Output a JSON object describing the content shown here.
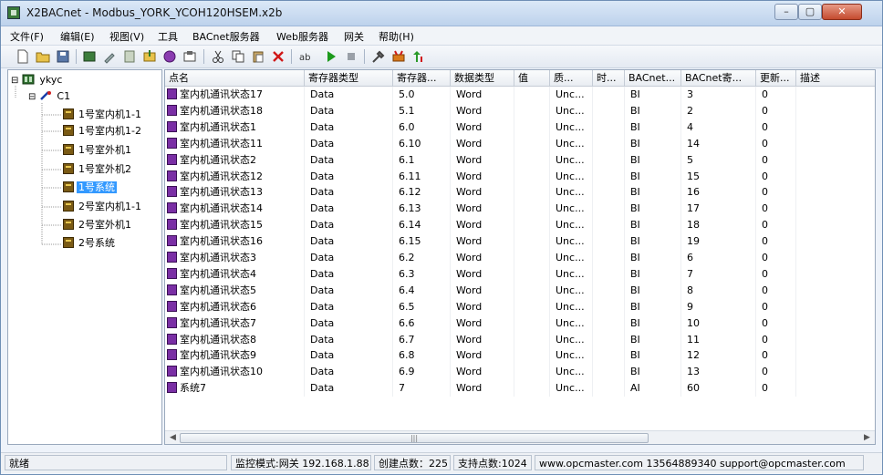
{
  "window": {
    "title": "X2BACnet - Modbus_YORK_YCOH120HSEM.x2b"
  },
  "menu": [
    "文件(F)",
    "编辑(E)",
    "视图(V)",
    "工具",
    "BACnet服务器",
    "Web服务器",
    "网关",
    "帮助(H)"
  ],
  "toolbar_icons": [
    "new-file-icon",
    "open-folder-icon",
    "save-icon",
    "add-device-icon",
    "wizard-icon",
    "properties-icon",
    "import-icon",
    "export-icon",
    "settings-icon",
    "cut-icon",
    "copy-icon",
    "paste-icon",
    "delete-icon",
    "rename-icon",
    "run-icon",
    "stop-icon",
    "tools-icon",
    "monitor-icon",
    "upgrade-icon"
  ],
  "tree": {
    "root": "ykyc",
    "channel": "C1",
    "devices": [
      "1号室内机1-1",
      "1号室内机1-2",
      "1号室外机1",
      "1号室外机2",
      "1号系统",
      "2号室内机1-1",
      "2号室外机1",
      "2号系统"
    ],
    "selected": "1号系统"
  },
  "table": {
    "columns": [
      "点名",
      "寄存器类型",
      "寄存器...",
      "数据类型",
      "值",
      "质...",
      "时...",
      "BACnet...",
      "BACnet寄...",
      "更新...",
      "描述"
    ],
    "rows": [
      [
        "室内机通讯状态17",
        "Data",
        "5.0",
        "Word",
        "",
        "Unc...",
        "",
        "BI",
        "3",
        "0",
        ""
      ],
      [
        "室内机通讯状态18",
        "Data",
        "5.1",
        "Word",
        "",
        "Unc...",
        "",
        "BI",
        "2",
        "0",
        ""
      ],
      [
        "室内机通讯状态1",
        "Data",
        "6.0",
        "Word",
        "",
        "Unc...",
        "",
        "BI",
        "4",
        "0",
        ""
      ],
      [
        "室内机通讯状态11",
        "Data",
        "6.10",
        "Word",
        "",
        "Unc...",
        "",
        "BI",
        "14",
        "0",
        ""
      ],
      [
        "室内机通讯状态2",
        "Data",
        "6.1",
        "Word",
        "",
        "Unc...",
        "",
        "BI",
        "5",
        "0",
        ""
      ],
      [
        "室内机通讯状态12",
        "Data",
        "6.11",
        "Word",
        "",
        "Unc...",
        "",
        "BI",
        "15",
        "0",
        ""
      ],
      [
        "室内机通讯状态13",
        "Data",
        "6.12",
        "Word",
        "",
        "Unc...",
        "",
        "BI",
        "16",
        "0",
        ""
      ],
      [
        "室内机通讯状态14",
        "Data",
        "6.13",
        "Word",
        "",
        "Unc...",
        "",
        "BI",
        "17",
        "0",
        ""
      ],
      [
        "室内机通讯状态15",
        "Data",
        "6.14",
        "Word",
        "",
        "Unc...",
        "",
        "BI",
        "18",
        "0",
        ""
      ],
      [
        "室内机通讯状态16",
        "Data",
        "6.15",
        "Word",
        "",
        "Unc...",
        "",
        "BI",
        "19",
        "0",
        ""
      ],
      [
        "室内机通讯状态3",
        "Data",
        "6.2",
        "Word",
        "",
        "Unc...",
        "",
        "BI",
        "6",
        "0",
        ""
      ],
      [
        "室内机通讯状态4",
        "Data",
        "6.3",
        "Word",
        "",
        "Unc...",
        "",
        "BI",
        "7",
        "0",
        ""
      ],
      [
        "室内机通讯状态5",
        "Data",
        "6.4",
        "Word",
        "",
        "Unc...",
        "",
        "BI",
        "8",
        "0",
        ""
      ],
      [
        "室内机通讯状态6",
        "Data",
        "6.5",
        "Word",
        "",
        "Unc...",
        "",
        "BI",
        "9",
        "0",
        ""
      ],
      [
        "室内机通讯状态7",
        "Data",
        "6.6",
        "Word",
        "",
        "Unc...",
        "",
        "BI",
        "10",
        "0",
        ""
      ],
      [
        "室内机通讯状态8",
        "Data",
        "6.7",
        "Word",
        "",
        "Unc...",
        "",
        "BI",
        "11",
        "0",
        ""
      ],
      [
        "室内机通讯状态9",
        "Data",
        "6.8",
        "Word",
        "",
        "Unc...",
        "",
        "BI",
        "12",
        "0",
        ""
      ],
      [
        "室内机通讯状态10",
        "Data",
        "6.9",
        "Word",
        "",
        "Unc...",
        "",
        "BI",
        "13",
        "0",
        ""
      ],
      [
        "系统7",
        "Data",
        "7",
        "Word",
        "",
        "Unc...",
        "",
        "AI",
        "60",
        "0",
        ""
      ]
    ]
  },
  "status": {
    "ready": "就绪",
    "mode": "监控模式:网关 192.168.1.88",
    "created": "创建点数：225",
    "supported": "支持点数:1024",
    "contact": "www.opcmaster.com 13564889340 support@opcmaster.com"
  },
  "colors": {
    "selection": "#3399ff",
    "point_icon": "#7a2fa5",
    "device_icon": "#7a5a14"
  }
}
